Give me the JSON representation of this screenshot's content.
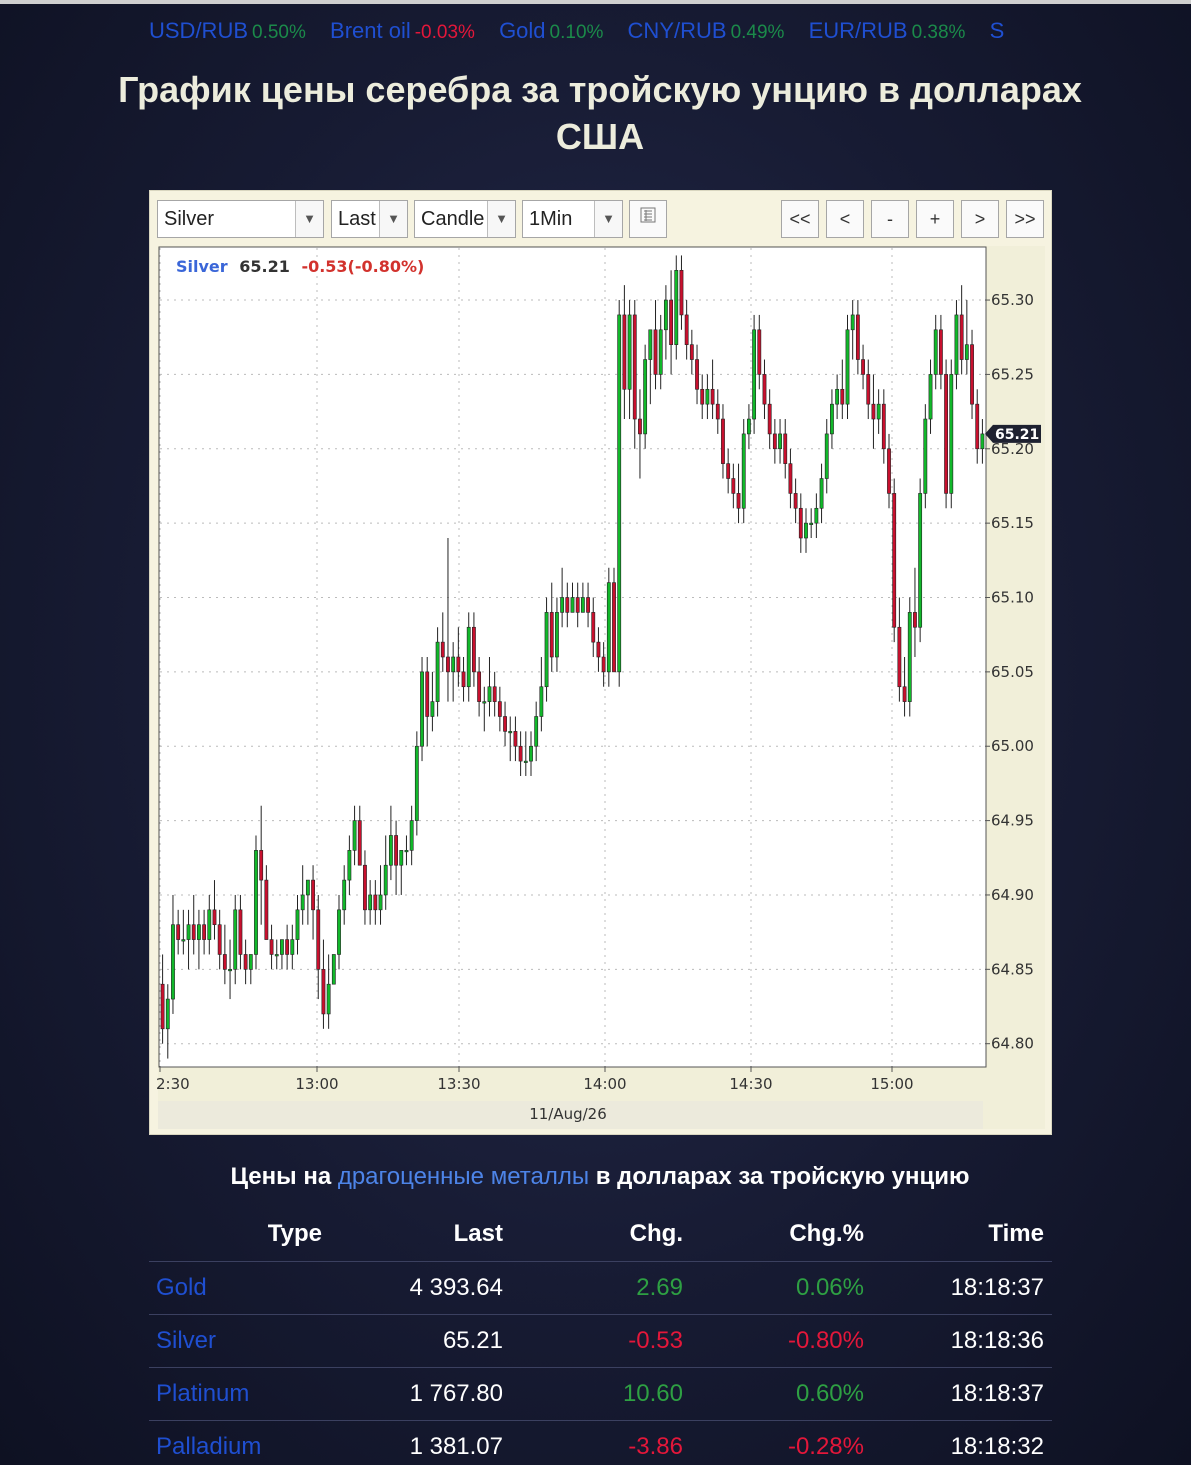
{
  "ticker": [
    {
      "name": "USD/RUB",
      "value": "0.50%",
      "dir": "pos"
    },
    {
      "name": "Brent oil",
      "value": "-0.03%",
      "dir": "neg"
    },
    {
      "name": "Gold",
      "value": "0.10%",
      "dir": "pos"
    },
    {
      "name": "CNY/RUB",
      "value": "0.49%",
      "dir": "pos"
    },
    {
      "name": "EUR/RUB",
      "value": "0.38%",
      "dir": "pos"
    },
    {
      "name": "S",
      "value": "",
      "dir": "pos"
    }
  ],
  "page_title": "График цены серебра за тройскую унцию в долларах США",
  "toolbar": {
    "symbol": "Silver",
    "price_type": "Last",
    "chart_style": "Candle",
    "interval": "1Min",
    "buttons": [
      "<<",
      "<",
      "-",
      "+",
      ">",
      ">>"
    ]
  },
  "chart_header": {
    "symbol": "Silver",
    "price": "65.21",
    "change": "-0.53(-0.80%)"
  },
  "chart_data": {
    "type": "candlestick",
    "date_label": "11/Aug/26",
    "x_ticks": [
      "2:30",
      "13:00",
      "13:30",
      "14:00",
      "14:30",
      "15:00"
    ],
    "y_ticks": [
      "65.30",
      "65.25",
      "65.20",
      "65.15",
      "65.10",
      "65.05",
      "65.00",
      "64.95",
      "64.90",
      "64.85",
      "64.80"
    ],
    "ylim": [
      64.785,
      65.335
    ],
    "last_price_label": "65.21",
    "colors": {
      "up": "#11b82a",
      "down": "#c8102e",
      "wick": "#222222"
    },
    "candles": [
      [
        64.84,
        64.86,
        64.8,
        64.81
      ],
      [
        64.81,
        64.84,
        64.79,
        64.83
      ],
      [
        64.83,
        64.9,
        64.82,
        64.88
      ],
      [
        64.88,
        64.89,
        64.86,
        64.87
      ],
      [
        64.87,
        64.89,
        64.86,
        64.87
      ],
      [
        64.87,
        64.89,
        64.85,
        64.88
      ],
      [
        64.88,
        64.9,
        64.86,
        64.87
      ],
      [
        64.87,
        64.89,
        64.85,
        64.88
      ],
      [
        64.88,
        64.89,
        64.86,
        64.87
      ],
      [
        64.87,
        64.9,
        64.86,
        64.89
      ],
      [
        64.89,
        64.91,
        64.87,
        64.88
      ],
      [
        64.88,
        64.89,
        64.85,
        64.86
      ],
      [
        64.86,
        64.88,
        64.84,
        64.85
      ],
      [
        64.85,
        64.87,
        64.83,
        64.85
      ],
      [
        64.85,
        64.9,
        64.84,
        64.89
      ],
      [
        64.89,
        64.9,
        64.85,
        64.86
      ],
      [
        64.86,
        64.87,
        64.84,
        64.85
      ],
      [
        64.85,
        64.86,
        64.84,
        64.86
      ],
      [
        64.86,
        64.94,
        64.85,
        64.93
      ],
      [
        64.93,
        64.96,
        64.88,
        64.91
      ],
      [
        64.91,
        64.92,
        64.87,
        64.87
      ],
      [
        64.87,
        64.88,
        64.85,
        64.86
      ],
      [
        64.86,
        64.87,
        64.85,
        64.86
      ],
      [
        64.86,
        64.87,
        64.85,
        64.87
      ],
      [
        64.87,
        64.88,
        64.85,
        64.86
      ],
      [
        64.86,
        64.88,
        64.85,
        64.87
      ],
      [
        64.87,
        64.9,
        64.86,
        64.89
      ],
      [
        64.89,
        64.92,
        64.88,
        64.9
      ],
      [
        64.9,
        64.91,
        64.88,
        64.91
      ],
      [
        64.91,
        64.92,
        64.87,
        64.89
      ],
      [
        64.89,
        64.9,
        64.83,
        64.85
      ],
      [
        64.85,
        64.87,
        64.81,
        64.82
      ],
      [
        64.82,
        64.86,
        64.81,
        64.84
      ],
      [
        64.84,
        64.86,
        64.84,
        64.86
      ],
      [
        64.86,
        64.9,
        64.85,
        64.89
      ],
      [
        64.89,
        64.92,
        64.88,
        64.91
      ],
      [
        64.91,
        64.94,
        64.9,
        64.93
      ],
      [
        64.93,
        64.96,
        64.92,
        64.95
      ],
      [
        64.95,
        64.96,
        64.92,
        64.92
      ],
      [
        64.92,
        64.93,
        64.88,
        64.89
      ],
      [
        64.89,
        64.91,
        64.88,
        64.9
      ],
      [
        64.9,
        64.91,
        64.88,
        64.89
      ],
      [
        64.89,
        64.92,
        64.88,
        64.9
      ],
      [
        64.9,
        64.94,
        64.89,
        64.92
      ],
      [
        64.92,
        64.96,
        64.91,
        64.94
      ],
      [
        64.94,
        64.95,
        64.9,
        64.92
      ],
      [
        64.92,
        64.93,
        64.9,
        64.93
      ],
      [
        64.93,
        64.94,
        64.92,
        64.93
      ],
      [
        64.93,
        64.96,
        64.92,
        64.95
      ],
      [
        64.95,
        65.01,
        64.94,
        65.0
      ],
      [
        65.0,
        65.06,
        64.99,
        65.05
      ],
      [
        65.05,
        65.06,
        65.0,
        65.02
      ],
      [
        65.02,
        65.05,
        65.01,
        65.03
      ],
      [
        65.03,
        65.08,
        65.02,
        65.07
      ],
      [
        65.07,
        65.09,
        65.05,
        65.06
      ],
      [
        65.06,
        65.14,
        65.03,
        65.05
      ],
      [
        65.05,
        65.07,
        65.03,
        65.06
      ],
      [
        65.06,
        65.08,
        65.04,
        65.05
      ],
      [
        65.05,
        65.06,
        65.03,
        65.04
      ],
      [
        65.04,
        65.09,
        65.03,
        65.08
      ],
      [
        65.08,
        65.09,
        65.04,
        65.05
      ],
      [
        65.05,
        65.06,
        65.02,
        65.03
      ],
      [
        65.03,
        65.04,
        65.01,
        65.03
      ],
      [
        65.03,
        65.06,
        65.02,
        65.04
      ],
      [
        65.04,
        65.05,
        65.02,
        65.03
      ],
      [
        65.03,
        65.04,
        65.01,
        65.02
      ],
      [
        65.02,
        65.03,
        65.0,
        65.01
      ],
      [
        65.01,
        65.02,
        64.99,
        65.01
      ],
      [
        65.01,
        65.02,
        64.99,
        65.0
      ],
      [
        65.0,
        65.01,
        64.98,
        64.99
      ],
      [
        64.99,
        65.01,
        64.98,
        64.99
      ],
      [
        64.99,
        65.01,
        64.98,
        65.0
      ],
      [
        65.0,
        65.03,
        64.99,
        65.02
      ],
      [
        65.02,
        65.06,
        65.01,
        65.04
      ],
      [
        65.04,
        65.1,
        65.03,
        65.09
      ],
      [
        65.09,
        65.11,
        65.05,
        65.06
      ],
      [
        65.06,
        65.1,
        65.05,
        65.09
      ],
      [
        65.09,
        65.12,
        65.08,
        65.1
      ],
      [
        65.1,
        65.11,
        65.08,
        65.09
      ],
      [
        65.09,
        65.11,
        65.09,
        65.1
      ],
      [
        65.1,
        65.11,
        65.08,
        65.09
      ],
      [
        65.09,
        65.11,
        65.09,
        65.1
      ],
      [
        65.1,
        65.11,
        65.08,
        65.09
      ],
      [
        65.09,
        65.1,
        65.06,
        65.07
      ],
      [
        65.07,
        65.08,
        65.05,
        65.06
      ],
      [
        65.06,
        65.07,
        65.04,
        65.05
      ],
      [
        65.05,
        65.12,
        65.04,
        65.11
      ],
      [
        65.11,
        65.12,
        65.06,
        65.05
      ],
      [
        65.05,
        65.3,
        65.04,
        65.29
      ],
      [
        65.29,
        65.31,
        65.22,
        65.24
      ],
      [
        65.24,
        65.3,
        65.22,
        65.29
      ],
      [
        65.29,
        65.3,
        65.2,
        65.22
      ],
      [
        65.22,
        65.24,
        65.18,
        65.21
      ],
      [
        65.21,
        65.27,
        65.2,
        65.26
      ],
      [
        65.26,
        65.28,
        65.23,
        65.28
      ],
      [
        65.28,
        65.3,
        65.24,
        65.25
      ],
      [
        65.25,
        65.29,
        65.24,
        65.28
      ],
      [
        65.28,
        65.31,
        65.26,
        65.3
      ],
      [
        65.3,
        65.32,
        65.25,
        65.27
      ],
      [
        65.27,
        65.33,
        65.26,
        65.32
      ],
      [
        65.32,
        65.33,
        65.28,
        65.29
      ],
      [
        65.29,
        65.3,
        65.26,
        65.27
      ],
      [
        65.27,
        65.28,
        65.25,
        65.26
      ],
      [
        65.26,
        65.27,
        65.23,
        65.24
      ],
      [
        65.24,
        65.25,
        65.22,
        65.23
      ],
      [
        65.23,
        65.25,
        65.22,
        65.24
      ],
      [
        65.24,
        65.26,
        65.22,
        65.23
      ],
      [
        65.23,
        65.24,
        65.21,
        65.22
      ],
      [
        65.22,
        65.23,
        65.18,
        65.19
      ],
      [
        65.19,
        65.2,
        65.17,
        65.18
      ],
      [
        65.18,
        65.19,
        65.16,
        65.17
      ],
      [
        65.17,
        65.19,
        65.15,
        65.16
      ],
      [
        65.16,
        65.22,
        65.15,
        65.21
      ],
      [
        65.21,
        65.23,
        65.2,
        65.22
      ],
      [
        65.22,
        65.29,
        65.21,
        65.28
      ],
      [
        65.28,
        65.29,
        65.24,
        65.25
      ],
      [
        65.25,
        65.26,
        65.22,
        65.23
      ],
      [
        65.23,
        65.24,
        65.2,
        65.21
      ],
      [
        65.21,
        65.22,
        65.19,
        65.2
      ],
      [
        65.2,
        65.22,
        65.19,
        65.21
      ],
      [
        65.21,
        65.22,
        65.18,
        65.19
      ],
      [
        65.19,
        65.2,
        65.16,
        65.17
      ],
      [
        65.17,
        65.18,
        65.15,
        65.16
      ],
      [
        65.16,
        65.17,
        65.13,
        65.14
      ],
      [
        65.14,
        65.16,
        65.13,
        65.15
      ],
      [
        65.15,
        65.16,
        65.14,
        65.15
      ],
      [
        65.15,
        65.17,
        65.14,
        65.16
      ],
      [
        65.16,
        65.19,
        65.15,
        65.18
      ],
      [
        65.18,
        65.22,
        65.17,
        65.21
      ],
      [
        65.21,
        65.24,
        65.2,
        65.23
      ],
      [
        65.23,
        65.25,
        65.22,
        65.24
      ],
      [
        65.24,
        65.26,
        65.22,
        65.23
      ],
      [
        65.23,
        65.29,
        65.22,
        65.28
      ],
      [
        65.28,
        65.3,
        65.26,
        65.29
      ],
      [
        65.29,
        65.3,
        65.25,
        65.26
      ],
      [
        65.26,
        65.27,
        65.24,
        65.25
      ],
      [
        65.25,
        65.26,
        65.22,
        65.23
      ],
      [
        65.23,
        65.25,
        65.2,
        65.22
      ],
      [
        65.22,
        65.24,
        65.21,
        65.23
      ],
      [
        65.23,
        65.24,
        65.19,
        65.2
      ],
      [
        65.2,
        65.21,
        65.16,
        65.17
      ],
      [
        65.17,
        65.18,
        65.07,
        65.08
      ],
      [
        65.08,
        65.1,
        65.03,
        65.04
      ],
      [
        65.04,
        65.06,
        65.02,
        65.03
      ],
      [
        65.03,
        65.1,
        65.02,
        65.09
      ],
      [
        65.09,
        65.12,
        65.06,
        65.08
      ],
      [
        65.08,
        65.18,
        65.07,
        65.17
      ],
      [
        65.17,
        65.23,
        65.16,
        65.22
      ],
      [
        65.22,
        65.26,
        65.21,
        65.25
      ],
      [
        65.25,
        65.29,
        65.24,
        65.28
      ],
      [
        65.28,
        65.29,
        65.24,
        65.25
      ],
      [
        65.25,
        65.26,
        65.16,
        65.17
      ],
      [
        65.17,
        65.26,
        65.16,
        65.25
      ],
      [
        65.25,
        65.3,
        65.24,
        65.29
      ],
      [
        65.29,
        65.31,
        65.25,
        65.26
      ],
      [
        65.26,
        65.3,
        65.25,
        65.27
      ],
      [
        65.27,
        65.28,
        65.22,
        65.23
      ],
      [
        65.23,
        65.24,
        65.19,
        65.2
      ],
      [
        65.2,
        65.22,
        65.19,
        65.21
      ]
    ]
  },
  "section_title": {
    "before": "Цены на ",
    "link": "драгоценные металлы",
    "after": " в долларах за тройскую унцию"
  },
  "table": {
    "headers": [
      "Type",
      "Last",
      "Chg.",
      "Chg.%",
      "Time"
    ],
    "rows": [
      {
        "type": "Gold",
        "last": "4 393.64",
        "chg": "2.69",
        "pct": "0.06%",
        "time": "18:18:37",
        "dir": "pos"
      },
      {
        "type": "Silver",
        "last": "65.21",
        "chg": "-0.53",
        "pct": "-0.80%",
        "time": "18:18:36",
        "dir": "neg"
      },
      {
        "type": "Platinum",
        "last": "1 767.80",
        "chg": "10.60",
        "pct": "0.60%",
        "time": "18:18:37",
        "dir": "pos"
      },
      {
        "type": "Palladium",
        "last": "1 381.07",
        "chg": "-3.86",
        "pct": "-0.28%",
        "time": "18:18:32",
        "dir": "neg"
      }
    ]
  }
}
